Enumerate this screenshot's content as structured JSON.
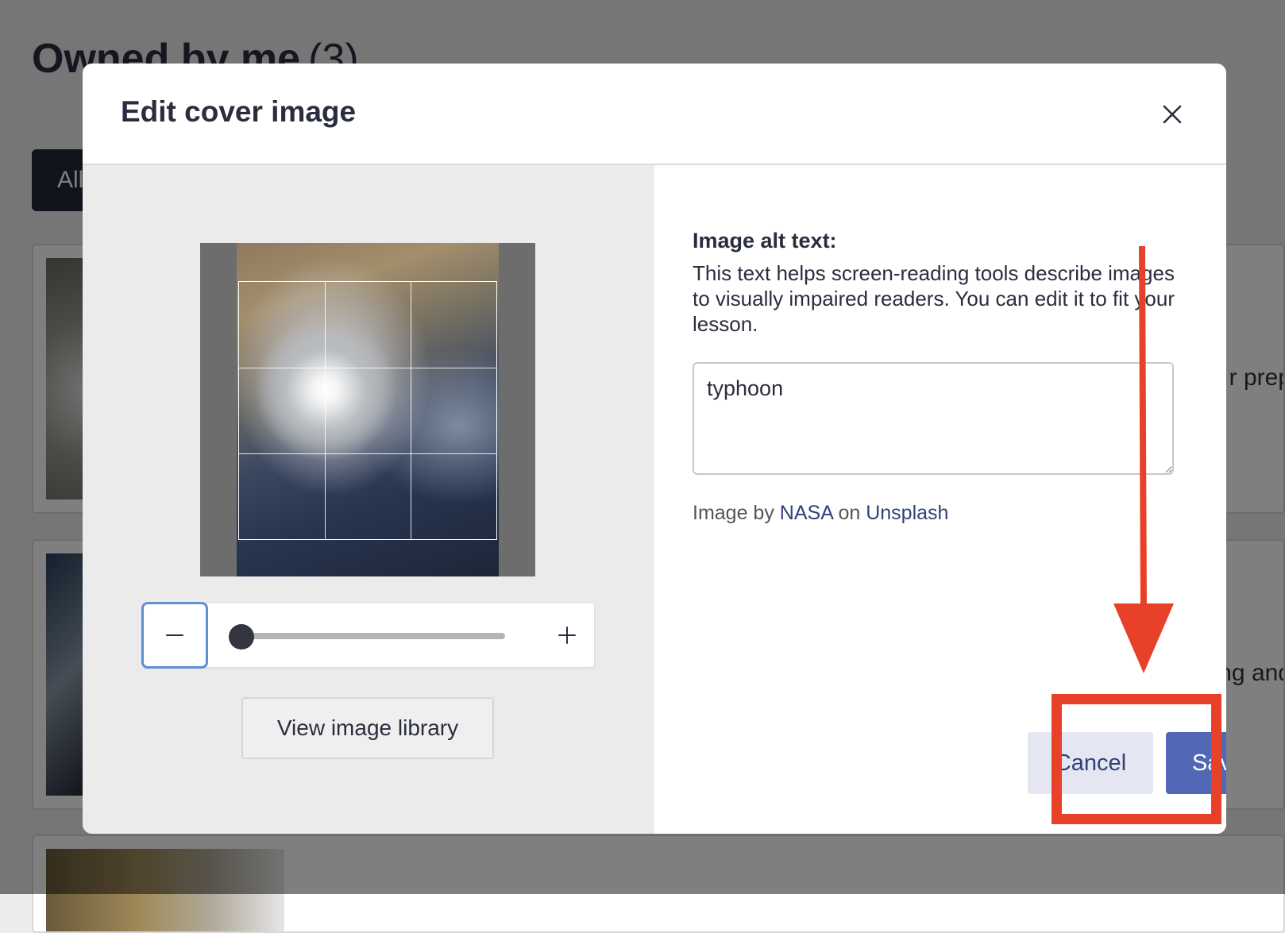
{
  "background_page": {
    "title": "Owned by me",
    "count": "(3)",
    "filter_label": "All",
    "card_snippets": [
      "r prep",
      "ng and"
    ]
  },
  "modal": {
    "title": "Edit cover image",
    "close_icon": "close-icon",
    "crop": {
      "zoom_level": 0,
      "minus_icon": "minus-icon",
      "plus_icon": "plus-icon"
    },
    "view_library_label": "View image library",
    "alt_text": {
      "label": "Image alt text:",
      "help": "This text helps screen-reading tools describe images to visually impaired readers. You can edit it to fit your lesson.",
      "value": "typhoon"
    },
    "credit": {
      "prefix": "Image by",
      "author": "NASA",
      "middle": "on",
      "source": "Unsplash"
    },
    "buttons": {
      "cancel": "Cancel",
      "save": "Save"
    }
  },
  "colors": {
    "accent": "#5267b5",
    "annotation": "#e8412a",
    "link": "#30417a",
    "dark_text": "#2a2d3e"
  }
}
